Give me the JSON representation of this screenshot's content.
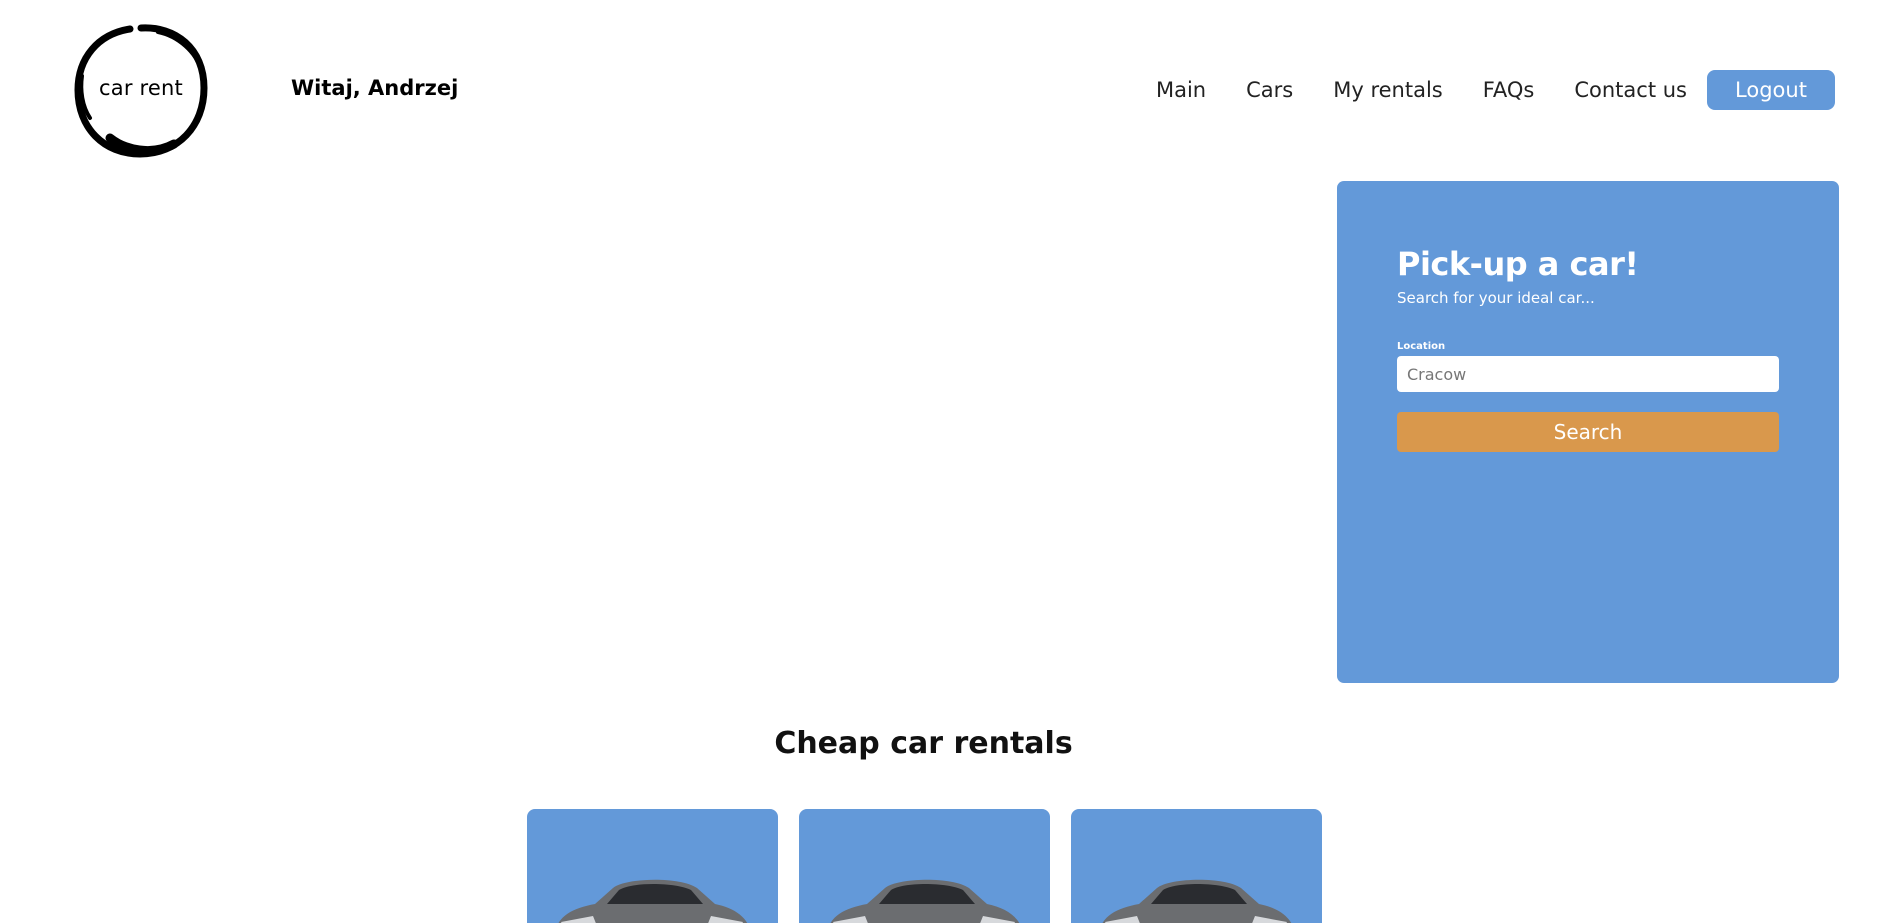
{
  "brand": {
    "logo_text": "car rent"
  },
  "header": {
    "greeting": "Witaj, Andrzej"
  },
  "nav": {
    "items": [
      "Main",
      "Cars",
      "My rentals",
      "FAQs",
      "Contact us"
    ],
    "logout_label": "Logout"
  },
  "search": {
    "title": "Pick-up a car!",
    "subtitle": "Search for your ideal car...",
    "location_label": "Location",
    "location_placeholder": "Cracow",
    "button_label": "Search"
  },
  "offers": {
    "title": "Cheap car rentals",
    "cards": [
      {
        "image": "car-icon"
      },
      {
        "image": "car-icon"
      },
      {
        "image": "car-icon"
      }
    ]
  },
  "colors": {
    "accent_blue": "#6399d9",
    "search_orange": "#d9984c",
    "background": "#ffffff"
  }
}
